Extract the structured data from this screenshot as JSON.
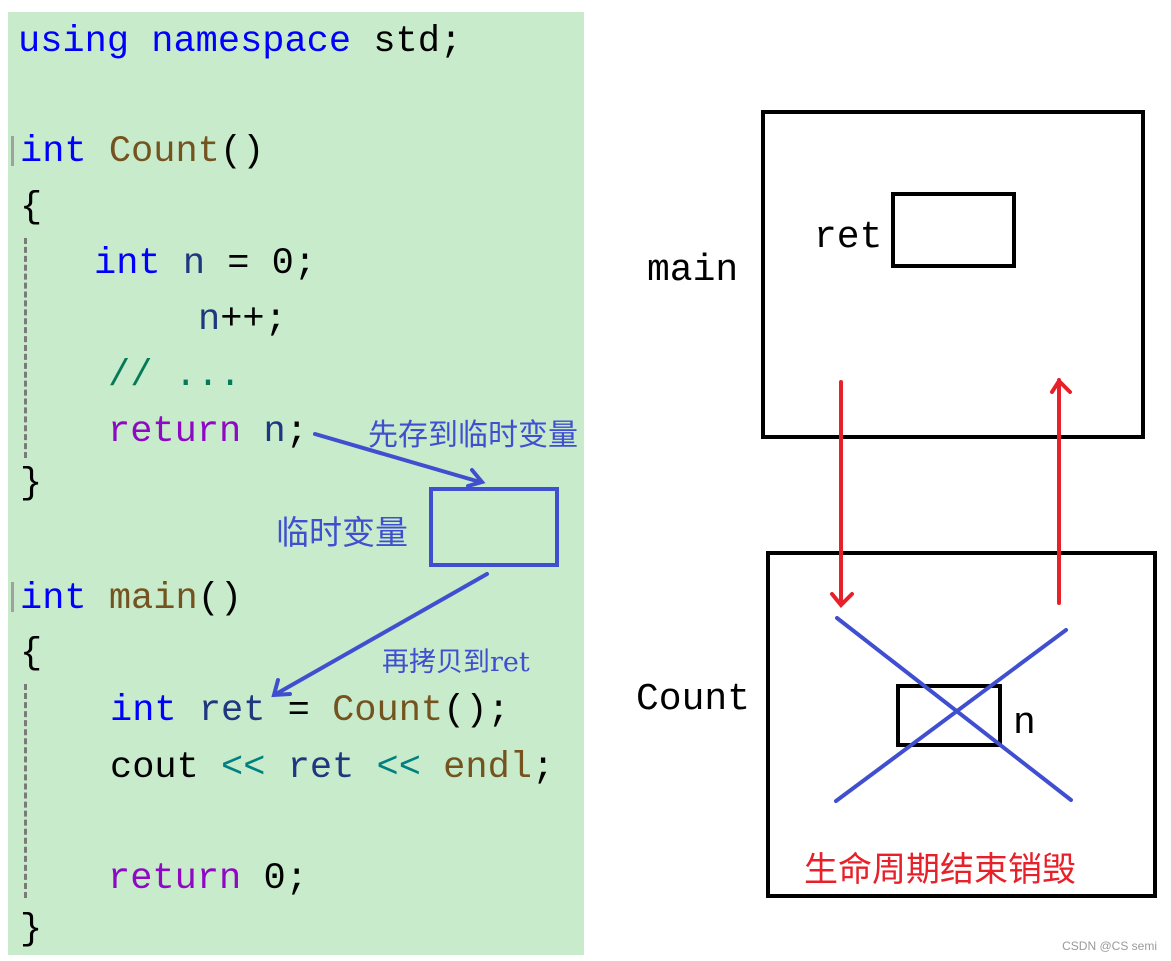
{
  "code": {
    "line_using": {
      "kw1": "using",
      "kw2": "namespace",
      "rest": "std;"
    },
    "count_sig": {
      "kw": "int",
      "fn": "Count",
      "paren": "()"
    },
    "brace_open_1": "{",
    "decl_n": {
      "kw": "int",
      "id": "n",
      "rest": " = 0;"
    },
    "incr": {
      "id": "n",
      "rest": "++;"
    },
    "comment": "// ...",
    "return_n": {
      "kw": "return",
      "id": "n",
      "rest": ";"
    },
    "brace_close_1": "}",
    "main_sig": {
      "kw": "int",
      "fn": "main",
      "paren": "()"
    },
    "brace_open_2": "{",
    "decl_ret": {
      "kw": "int",
      "id": "ret",
      "eq": " = ",
      "fn": "Count",
      "rest": "();"
    },
    "cout_line": {
      "cout": "cout",
      "op1": "<<",
      "id": "ret",
      "op2": "<<",
      "fn": "endl",
      "semi": ";"
    },
    "return_0": {
      "kw": "return",
      "rest": " 0;"
    },
    "brace_close_2": "}"
  },
  "annotations": {
    "store_temp": "先存到临时变量",
    "temp_var": "临时变量",
    "copy_to_ret": "再拷贝到ret"
  },
  "diagram": {
    "main_frame_label": "main",
    "ret_label": "ret",
    "count_frame_label": "Count",
    "n_label": "n",
    "destroyed_note": "生命周期结束销毁"
  },
  "colors": {
    "panel_bg": "#c7ebcb",
    "annotation_blue": "#3f4fcf",
    "arrow_red": "#e8202a"
  },
  "watermark": "CSDN @CS semi"
}
